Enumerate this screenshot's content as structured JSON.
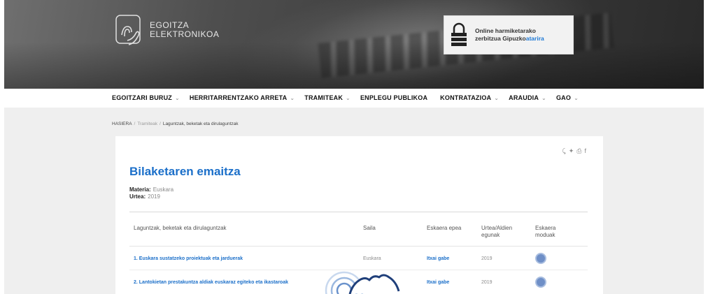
{
  "header": {
    "logo_line1": "EGOITZA",
    "logo_line2": "ELEKTRONIKOA",
    "login_line1": "Online harmiketarako",
    "login_line2_prefix": "zerbitzua Gipuzko",
    "login_line2_accent": "atarira"
  },
  "nav": {
    "items": [
      {
        "label": "EGOITZARI BURUZ",
        "chevron": "⌄"
      },
      {
        "label": "HERRITARRENTZAKO ARRETA",
        "chevron": "⌄"
      },
      {
        "label": "TRAMITEAK",
        "chevron": "⌄"
      },
      {
        "label": "ENPLEGU PUBLIKOA",
        "chevron": ""
      },
      {
        "label": "KONTRATAZIOA",
        "chevron": "⌄"
      },
      {
        "label": "ARAUDIA",
        "chevron": "⌄"
      },
      {
        "label": "GAO",
        "chevron": "⌄"
      }
    ]
  },
  "breadcrumb": {
    "home": "HASIERA",
    "level2": "Tramiteak",
    "current": "Laguntzak, beketak eta dirulaguntzak"
  },
  "share": {
    "icons": [
      "share-icon",
      "twitter-icon",
      "print-icon",
      "facebook-icon"
    ]
  },
  "main": {
    "title": "Bilaketaren emaitza",
    "materia_label": "Materia:",
    "materia_value": "Euskara",
    "urtea_label": "Urtea:",
    "urtea_value": "2019"
  },
  "table": {
    "headers": [
      "Laguntzak, beketak eta dirulaguntzak",
      "Saila",
      "Eskaera epea",
      "Urtea/Aldien egunak",
      "Eskaera moduak"
    ],
    "rows": [
      {
        "title": "1. Euskara sustatzeko proiektuak eta jarduerak",
        "dept": "Euskara",
        "link": "Itxai gabe",
        "year": "2019"
      },
      {
        "title": "2. Lantokietan prestakuntza aldiak euskaraz egiteko eta ikastaroak",
        "dept": "",
        "link": "Itxai gabe",
        "year": "2019"
      }
    ]
  },
  "colors": {
    "accent": "#1b6fc9",
    "mode_icon": "#6f8fc7",
    "page_bg": "#efefef"
  }
}
